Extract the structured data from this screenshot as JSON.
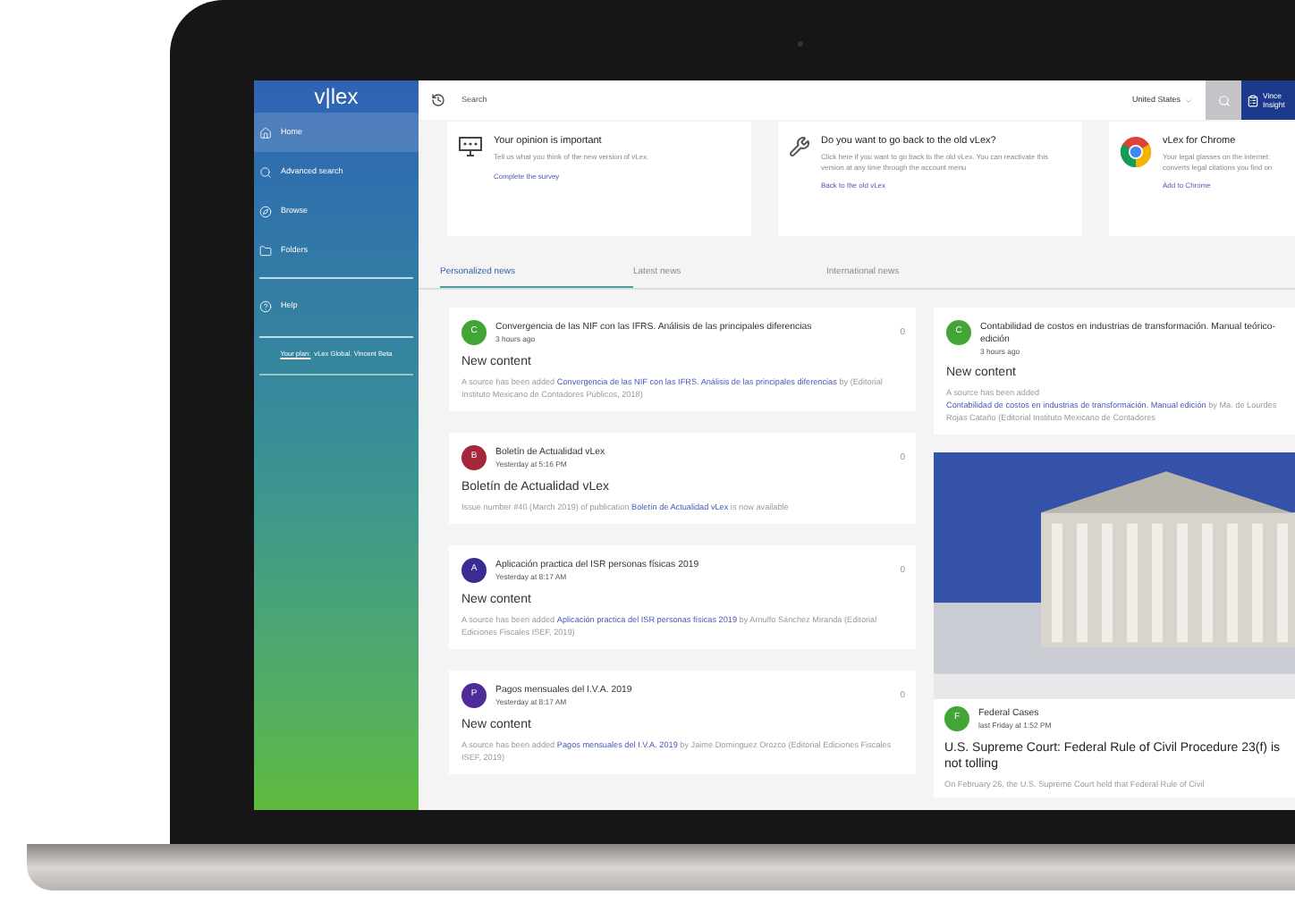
{
  "sidebar": {
    "logo": "v|lex",
    "items": [
      {
        "kind": "home",
        "label": "Home",
        "selected": true
      },
      {
        "kind": "search",
        "label": "Advanced search",
        "selected": false
      },
      {
        "kind": "compass",
        "label": "Browse",
        "selected": false
      },
      {
        "kind": "folder",
        "label": "Folders",
        "selected": false
      },
      {
        "kind": "help",
        "label": "Help",
        "selected": false
      }
    ],
    "plan": {
      "link": "Your plan:",
      "text": "vLex Global. Vincent Beta"
    }
  },
  "topbar": {
    "search_placeholder": "Search",
    "country": "United States",
    "user_name": "Vince",
    "user_sub": "Insight"
  },
  "promos": [
    {
      "kind": "survey",
      "title": "Your opinion is important",
      "text": "Tell us what you think of the new version of vLex.",
      "link": "Complete the survey"
    },
    {
      "kind": "tools",
      "title": "Do you want to go back to the old vLex?",
      "text": "Click here if you want to go back to the old vLex. You can reactivate this version at any time through the account menu",
      "link": "Back to the old vLex"
    },
    {
      "kind": "chrome",
      "title": "vLex for Chrome",
      "text": "Your legal glasses on the internet: converts legal citations you find on",
      "link": "Add to Chrome"
    }
  ],
  "tabs": [
    {
      "label": "Personalized news",
      "selected": true
    },
    {
      "label": "Latest news",
      "selected": false
    },
    {
      "label": "International news",
      "selected": false
    }
  ],
  "news_left": [
    {
      "kind": "text",
      "letter": "C",
      "color": "#43a535",
      "title": "Convergencia de las NIF con las IFRS. Análisis de las principales diferencias",
      "time": "3 hours ago",
      "count": "0",
      "heading": "New content",
      "prefix": "A source has been added ",
      "link": "Convergencia de las NIF con las IFRS. Análisis de las principales diferencias",
      "suffix": " by (Editorial Instituto Mexicano de Contadores Públicos, 2018)"
    },
    {
      "kind": "text",
      "letter": "B",
      "color": "#a5283a",
      "title": "Boletín de Actualidad vLex",
      "time": "Yesterday at 5:16 PM",
      "count": "0",
      "heading": "Boletín de Actualidad vLex",
      "prefix": "Issue number #40 (March 2019) of publication ",
      "link": "Boletín de Actualidad vLex",
      "suffix": " is now available"
    },
    {
      "kind": "text",
      "letter": "A",
      "color": "#3a2d91",
      "title": "Aplicación practica del ISR personas físicas 2019",
      "time": "Yesterday at 8:17 AM",
      "count": "0",
      "heading": "New content",
      "prefix": "A source has been added ",
      "link": "Aplicación practica del ISR personas físicas 2019",
      "suffix": " by Arnulfo Sánchez Miranda (Editorial Ediciones Fiscales ISEF, 2019)"
    },
    {
      "kind": "text",
      "letter": "P",
      "color": "#4e2b98",
      "title": "Pagos mensuales del I.V.A. 2019",
      "time": "Yesterday at 8:17 AM",
      "count": "0",
      "heading": "New content",
      "prefix": "A source has been added ",
      "link": "Pagos mensuales del I.V.A. 2019",
      "suffix": " by Jaime Domínguez Orozco (Editorial Ediciones Fiscales ISEF, 2019)"
    }
  ],
  "news_right": [
    {
      "kind": "text",
      "letter": "C",
      "color": "#43a535",
      "title": "Contabilidad de costos en industrias de transformación. Manual teórico- edición",
      "time": "3 hours ago",
      "heading": "New content",
      "prefix": "A source has been added ",
      "link": "Contabilidad de costos en industrias de transformación. Manual edición",
      "suffix": " by Ma. de Lourdes Rojas Cataño (Editorial Instituto Mexicano de Contadores"
    },
    {
      "kind": "image",
      "letter": "F",
      "color": "#43a535",
      "title": "Federal Cases",
      "time": "last Friday at 1:52 PM",
      "heading": "U.S. Supreme Court: Federal Rule of Civil Procedure 23(f) is not tolling",
      "prefix": "On February 26, the U.S. Supreme Court held that Federal Rule of Civil"
    }
  ]
}
